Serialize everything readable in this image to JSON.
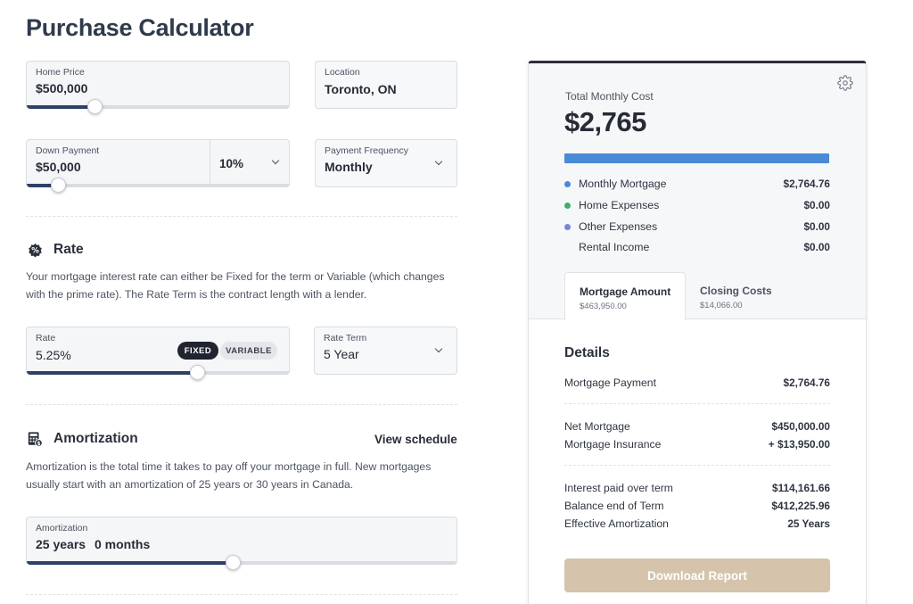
{
  "page": {
    "title": "Purchase Calculator"
  },
  "home_price": {
    "label": "Home Price",
    "value": "$500,000",
    "slider_fraction": 0.26
  },
  "location": {
    "label": "Location",
    "value": "Toronto, ON"
  },
  "down_payment": {
    "label": "Down Payment",
    "value": "$50,000",
    "percent": "10%",
    "slider_fraction": 0.12
  },
  "payment_frequency": {
    "label": "Payment Frequency",
    "value": "Monthly"
  },
  "rate_section": {
    "title": "Rate",
    "description": "Your mortgage interest rate can either be Fixed for the term or Variable (which changes with the prime rate). The Rate Term is the contract length with a lender."
  },
  "rate": {
    "label": "Rate",
    "value": "5.25%",
    "fixed_label": "FIXED",
    "variable_label": "VARIABLE",
    "slider_fraction": 0.65
  },
  "rate_term": {
    "label": "Rate Term",
    "value": "5 Year"
  },
  "amortization_section": {
    "title": "Amortization",
    "view_schedule": "View schedule",
    "description": "Amortization is the total time it takes to pay off your mortgage in full. New mortgages usually start with an amortization of 25 years or 30 years in Canada."
  },
  "amortization": {
    "label": "Amortization",
    "years": "25 years",
    "months": "0 months",
    "slider_fraction": 0.48
  },
  "summary": {
    "total_label": "Total Monthly Cost",
    "total_value": "$2,765",
    "breakdown": [
      {
        "label": "Monthly Mortgage",
        "value": "$2,764.76",
        "color": "#4a8ad6"
      },
      {
        "label": "Home Expenses",
        "value": "$0.00",
        "color": "#3fae6a"
      },
      {
        "label": "Other Expenses",
        "value": "$0.00",
        "color": "#7b84d4"
      },
      {
        "label": "Rental Income",
        "value": "$0.00",
        "color": ""
      }
    ],
    "tabs": [
      {
        "label": "Mortgage Amount",
        "sub": "$463,950.00"
      },
      {
        "label": "Closing Costs",
        "sub": "$14,066.00"
      }
    ],
    "details_title": "Details",
    "details": [
      {
        "label": "Mortgage Payment",
        "value": "$2,764.76"
      },
      {
        "label": "Net Mortgage",
        "value": "$450,000.00"
      },
      {
        "label": "Mortgage Insurance",
        "value": "+ $13,950.00"
      },
      {
        "label": "Interest paid over term",
        "value": "$114,161.66"
      },
      {
        "label": "Balance end of Term",
        "value": "$412,225.96"
      },
      {
        "label": "Effective Amortization",
        "value": "25 Years"
      }
    ],
    "download_label": "Download Report"
  },
  "colors": {
    "accent_bar": "#4a8ad6",
    "download_button": "#d5c4ab",
    "slider_fill": "#2f3f66"
  }
}
